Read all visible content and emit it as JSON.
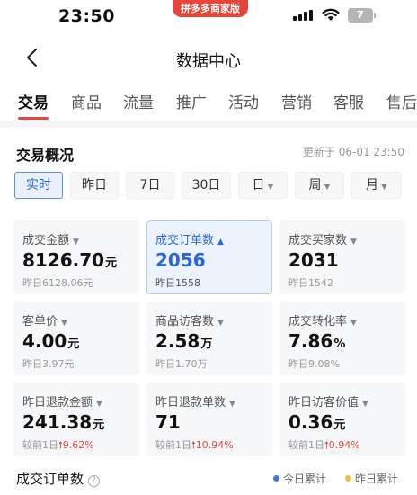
{
  "status_bar": {
    "time": "23:50",
    "pill": "拼多多商家版",
    "battery": "7"
  },
  "nav": {
    "title": "数据中心"
  },
  "tabs": [
    "交易",
    "商品",
    "流量",
    "推广",
    "活动",
    "营销",
    "客服",
    "售后"
  ],
  "overview": {
    "title": "交易概况",
    "updated": "更新于 06-01 23:50",
    "periods": [
      "实时",
      "昨日",
      "7日",
      "30日",
      "日",
      "周",
      "月"
    ]
  },
  "metrics": [
    {
      "label": "成交金额",
      "value": "8126.70",
      "unit": "元",
      "sub": "昨日6128.06元"
    },
    {
      "label": "成交订单数",
      "value": "2056",
      "unit": "",
      "sub": "昨日1558"
    },
    {
      "label": "成交买家数",
      "value": "2031",
      "unit": "",
      "sub": "昨日1542"
    },
    {
      "label": "客单价",
      "value": "4.00",
      "unit": "元",
      "sub": "昨日3.97元"
    },
    {
      "label": "商品访客数",
      "value": "2.58",
      "unit": "万",
      "sub": "昨日1.70万"
    },
    {
      "label": "成交转化率",
      "value": "7.86",
      "unit": "%",
      "sub": "昨日9.08%"
    },
    {
      "label": "昨日退款金额",
      "value": "241.38",
      "unit": "元",
      "sub_prefix": "较前1日",
      "sub_change": "9.62%"
    },
    {
      "label": "昨日退款单数",
      "value": "71",
      "unit": "",
      "sub_prefix": "较前1日",
      "sub_change": "10.94%"
    },
    {
      "label": "昨日访客价值",
      "value": "0.36",
      "unit": "元",
      "sub_prefix": "较前1日",
      "sub_change": "0.94%"
    }
  ],
  "orders_chart": {
    "title": "成交订单数",
    "legend": [
      {
        "label": "今日累计",
        "color": "#3a7ae0"
      },
      {
        "label": "昨日累计",
        "color": "#f5b942"
      }
    ]
  },
  "colors": {
    "accent": "#e8453a",
    "active_blue": "#2b67d9"
  }
}
